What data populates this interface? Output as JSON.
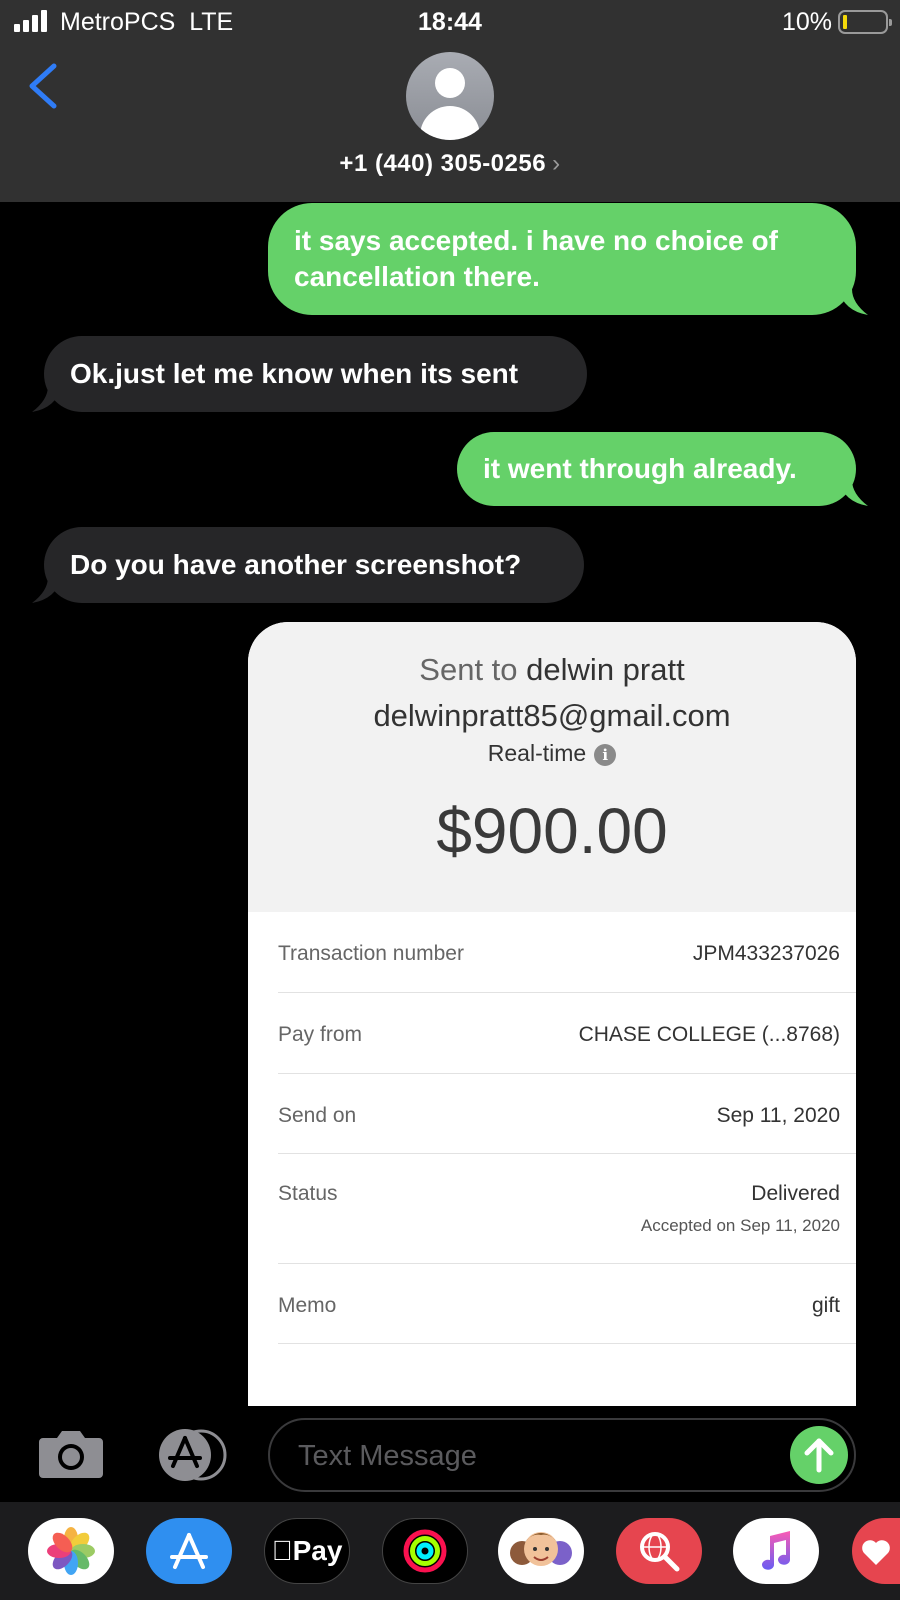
{
  "status_bar": {
    "carrier": "MetroPCS",
    "network": "LTE",
    "time": "18:44",
    "battery_percent": "10%",
    "battery_level": 0.1
  },
  "contact": {
    "name": "+1 (440) 305-0256",
    "chevron": "›"
  },
  "messages": [
    {
      "direction": "sent",
      "text": "it says accepted. i have no choice of cancellation there."
    },
    {
      "direction": "received",
      "text": "Ok.just let me know when its sent"
    },
    {
      "direction": "sent",
      "text": "it went through already."
    },
    {
      "direction": "received",
      "text": "Do you have another screenshot?"
    }
  ],
  "payment_card": {
    "sent_to_label": "Sent to",
    "recipient_name": "delwin pratt",
    "recipient_email": "delwinpratt85@gmail.com",
    "speed": "Real-time",
    "info_glyph": "i",
    "amount": "$900.00",
    "rows": [
      {
        "label": "Transaction number",
        "value": "JPM433237026"
      },
      {
        "label": "Pay from",
        "value": "CHASE COLLEGE (...8768)"
      },
      {
        "label": "Send on",
        "value": "Sep 11, 2020"
      },
      {
        "label": "Status",
        "value": "Delivered",
        "sub": "Accepted on Sep 11, 2020"
      },
      {
        "label": "Memo",
        "value": "gift"
      }
    ]
  },
  "compose": {
    "placeholder": "Text Message"
  },
  "app_drawer": {
    "apple_pay_label": "Pay",
    "apps": [
      "photos-icon",
      "app-store-icon",
      "apple-pay-icon",
      "activity-icon",
      "memoji-icon",
      "image-search-icon",
      "music-icon",
      "heart-icon"
    ]
  },
  "colors": {
    "sent_bubble": "#65d169",
    "received_bubble": "#262628",
    "header": "#313131",
    "back_arrow": "#2f7cf6",
    "battery_fill": "#f5d90a"
  }
}
